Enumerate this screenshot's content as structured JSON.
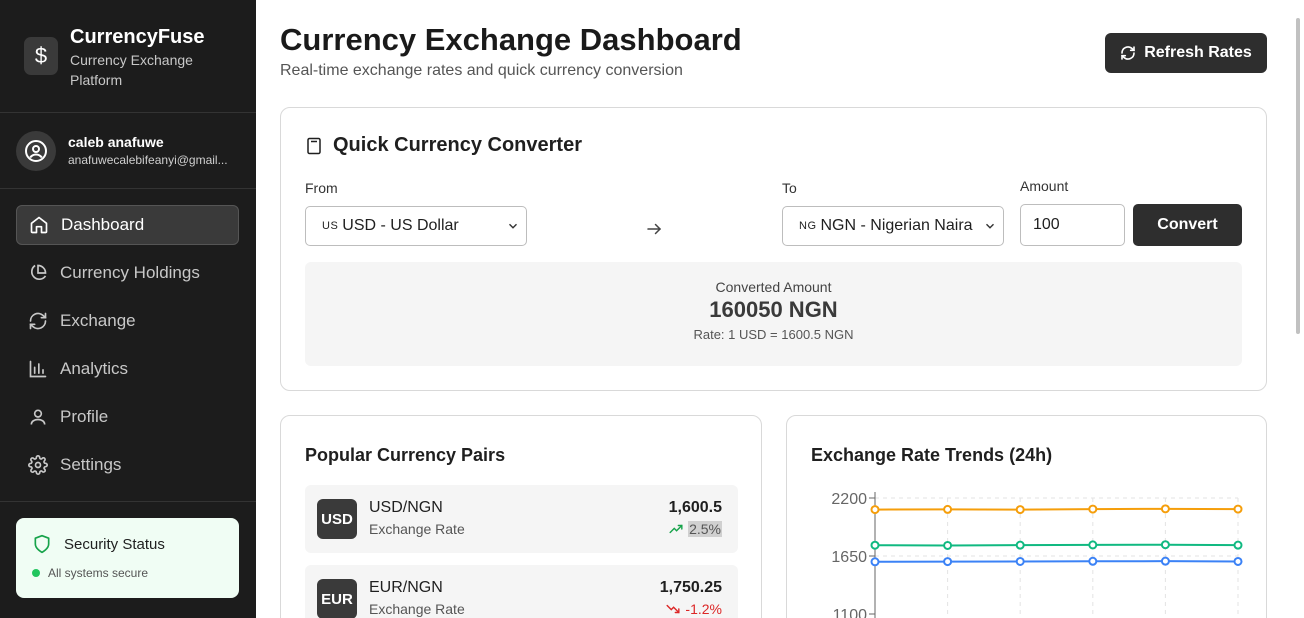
{
  "brand": {
    "name": "CurrencyFuse",
    "subtitle": "Currency Exchange Platform"
  },
  "user": {
    "name": "caleb anafuwe",
    "email": "anafuwecalebifeanyi@gmail..."
  },
  "nav": [
    {
      "label": "Dashboard",
      "icon": "home-icon",
      "active": true
    },
    {
      "label": "Currency Holdings",
      "icon": "pie-chart-icon"
    },
    {
      "label": "Exchange",
      "icon": "refresh-icon"
    },
    {
      "label": "Analytics",
      "icon": "bar-chart-icon"
    },
    {
      "label": "Profile",
      "icon": "user-icon"
    },
    {
      "label": "Settings",
      "icon": "gear-icon"
    }
  ],
  "security": {
    "title": "Security Status",
    "status": "All systems secure",
    "color": "#22c55e"
  },
  "header": {
    "title": "Currency Exchange Dashboard",
    "subtitle": "Real-time exchange rates and quick currency conversion",
    "refresh_label": "Refresh Rates"
  },
  "converter": {
    "title": "Quick Currency Converter",
    "from_label": "From",
    "to_label": "To",
    "amount_label": "Amount",
    "from_flag": "US",
    "from_value": "USD - US Dollar",
    "to_flag": "NG",
    "to_value": "NGN - Nigerian Naira",
    "amount_value": "100",
    "convert_label": "Convert",
    "result_label": "Converted Amount",
    "result_amount": "160050 NGN",
    "result_rate": "Rate: 1 USD = 1600.5 NGN"
  },
  "pairs": {
    "title": "Popular Currency Pairs",
    "items": [
      {
        "badge": "USD",
        "name": "USD/NGN",
        "sub": "Exchange Rate",
        "value": "1,600.5",
        "change": "2.5%",
        "direction": "up"
      },
      {
        "badge": "EUR",
        "name": "EUR/NGN",
        "sub": "Exchange Rate",
        "value": "1,750.25",
        "change": "-1.2%",
        "direction": "down"
      }
    ]
  },
  "trends": {
    "title": "Exchange Rate Trends (24h)"
  },
  "chart_data": {
    "type": "line",
    "title": "Exchange Rate Trends (24h)",
    "y_ticks": [
      "2200",
      "1650",
      "1100"
    ],
    "ylim": [
      1100,
      2200
    ],
    "x": [
      1,
      2,
      3,
      4,
      5,
      6
    ],
    "series": [
      {
        "color": "#f59e0b",
        "values": [
          2090,
          2092,
          2090,
          2095,
          2097,
          2095
        ]
      },
      {
        "color": "#10b981",
        "values": [
          1752,
          1750,
          1753,
          1755,
          1757,
          1753
        ]
      },
      {
        "color": "#3b82f6",
        "values": [
          1595,
          1597,
          1598,
          1600,
          1601,
          1598
        ]
      }
    ],
    "grid": true
  }
}
